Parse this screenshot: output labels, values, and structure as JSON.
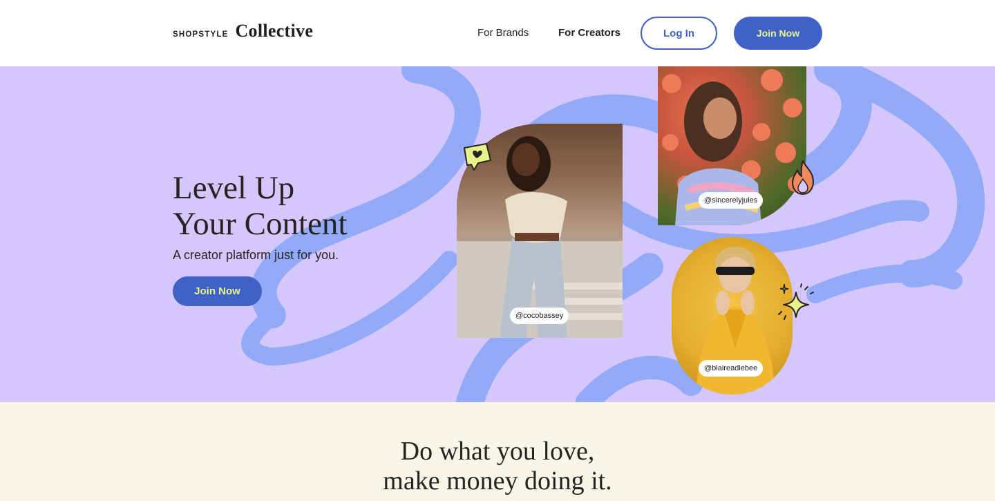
{
  "header": {
    "logo_small": "SHOPSTYLE",
    "logo_big": "Collective",
    "nav": {
      "for_brands": "For Brands",
      "for_creators": "For Creators"
    },
    "login_label": "Log In",
    "join_label": "Join Now"
  },
  "hero": {
    "title_line1": "Level Up",
    "title_line2": "Your Content",
    "subtitle": "A creator platform just for you.",
    "join_label": "Join Now",
    "creators": {
      "coco": "@cocobassey",
      "jules": "@sincerelyjules",
      "blaire": "@blaireadiebee"
    },
    "icons": {
      "heart_bubble": "heart-bubble-icon",
      "flame": "flame-icon",
      "sparkle": "sparkle-icon"
    }
  },
  "section2": {
    "title_line1": "Do what you love,",
    "title_line2": "make money doing it."
  },
  "colors": {
    "primary_blue": "#3f62c7",
    "button_text_yellow": "#ecf58a",
    "hero_bg": "#d5c6fc",
    "swirl": "#93aaf8",
    "section2_bg": "#f9f6e8"
  }
}
